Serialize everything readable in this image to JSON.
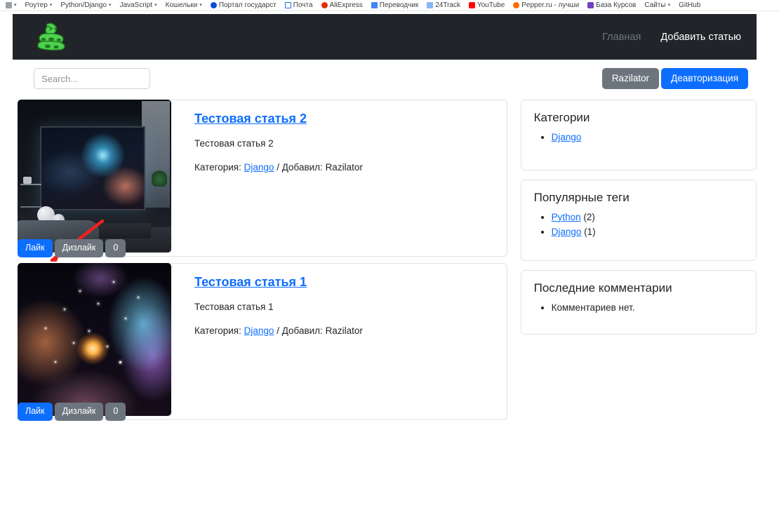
{
  "browser": {
    "bookmarks": [
      {
        "label": "",
        "icon": "folder-icon",
        "caret": true
      },
      {
        "label": "Роутер",
        "icon": "",
        "caret": true
      },
      {
        "label": "Python/Django",
        "icon": "",
        "caret": true
      },
      {
        "label": "JavaScript",
        "icon": "",
        "caret": true
      },
      {
        "label": "Кошельки",
        "icon": "",
        "caret": true
      },
      {
        "label": "Портал государст",
        "icon": "gosuslugi-icon",
        "caret": false
      },
      {
        "label": "Почта",
        "icon": "mail-icon",
        "caret": false
      },
      {
        "label": "AliExpress",
        "icon": "aliexpress-icon",
        "caret": false
      },
      {
        "label": "Переводчик",
        "icon": "translate-icon",
        "caret": false
      },
      {
        "label": "24Track",
        "icon": "track-icon",
        "caret": false
      },
      {
        "label": "YouTube",
        "icon": "youtube-icon",
        "caret": false
      },
      {
        "label": "Pepper.ru - лучши",
        "icon": "pepper-icon",
        "caret": false
      },
      {
        "label": "База Курсов",
        "icon": "baza-icon",
        "caret": false
      },
      {
        "label": "Сайты",
        "icon": "",
        "caret": true
      },
      {
        "label": "GitHub",
        "icon": "",
        "caret": false
      }
    ]
  },
  "navbar": {
    "logo_name": "python-snake-logo",
    "links": [
      {
        "label": "Главная",
        "state": "muted"
      },
      {
        "label": "Добавить статью",
        "state": "active"
      }
    ]
  },
  "toolbar": {
    "search_placeholder": "Search...",
    "search_value": "",
    "user_button": "Razilator",
    "logout_button": "Деавторизация"
  },
  "articles": [
    {
      "title": "Тестовая статья 2",
      "excerpt": "Тестовая статья 2",
      "meta_category_label": "Категория:",
      "category": "Django",
      "meta_separator": "/",
      "meta_author_label": "Добавил:",
      "author": "Razilator",
      "like_label": "Лайк",
      "dislike_label": "Дизлайк",
      "count": "0",
      "thumb": "dark-room-with-nebula-artwork",
      "annotation": "red-arrow"
    },
    {
      "title": "Тестовая статья 1",
      "excerpt": "Тестовая статья 1",
      "meta_category_label": "Категория:",
      "category": "Django",
      "meta_separator": "/",
      "meta_author_label": "Добавил:",
      "author": "Razilator",
      "like_label": "Лайк",
      "dislike_label": "Дизлайк",
      "count": "0",
      "thumb": "colorful-nebula",
      "annotation": ""
    }
  ],
  "sidebar": {
    "categories": {
      "title": "Категории",
      "items": [
        {
          "label": "Django",
          "count": ""
        }
      ]
    },
    "tags": {
      "title": "Популярные теги",
      "items": [
        {
          "label": "Python",
          "count": "(2)"
        },
        {
          "label": "Django",
          "count": "(1)"
        }
      ]
    },
    "comments": {
      "title": "Последние комментарии",
      "items": [
        {
          "label": "Комментариев нет.",
          "count": ""
        }
      ]
    }
  },
  "colors": {
    "navbar_bg": "#212529",
    "primary": "#0d6efd",
    "secondary": "#6c757d",
    "link": "#0d6efd",
    "logo_green": "#4ed24e",
    "annotation_red": "#ef2020"
  }
}
